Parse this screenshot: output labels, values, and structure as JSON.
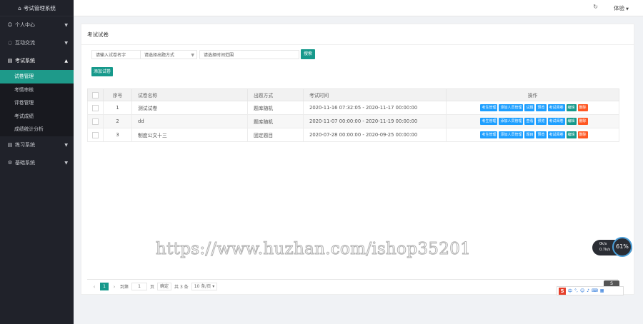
{
  "app_title": "考试管理系统",
  "sidebar": {
    "groups": [
      {
        "label": "个人中心"
      },
      {
        "label": "互动交流"
      },
      {
        "label": "考试系统"
      },
      {
        "label": "练习系统"
      },
      {
        "label": "基础系统"
      }
    ],
    "exam_subitems": [
      {
        "label": "试卷管理"
      },
      {
        "label": "考情审核"
      },
      {
        "label": "评卷管理"
      },
      {
        "label": "考试成绩"
      },
      {
        "label": "成绩统计分析"
      }
    ]
  },
  "header": {
    "user_name": "体验"
  },
  "page": {
    "title": "考试试卷",
    "filter": {
      "name_placeholder": "请输入试卷名字",
      "method_placeholder": "请选择出题方式",
      "time_placeholder": "请选择时间范围",
      "search_label": "搜索"
    },
    "new_button": "添加试卷"
  },
  "table": {
    "headers": [
      "序号",
      "试卷名称",
      "出题方式",
      "考试时间",
      "操作"
    ],
    "rows": [
      {
        "num": "1",
        "name": "测试试卷",
        "method": "题库随机",
        "time": "2020-11-16 07:32:05 - 2020-11-17 00:00:00",
        "ops": [
          "考生管理",
          "添加人员管理",
          "试题",
          "预览",
          "考试阅卷",
          "编辑",
          "删除"
        ]
      },
      {
        "num": "2",
        "name": "dd",
        "method": "题库随机",
        "time": "2020-11-07 00:00:00 - 2020-11-19 00:00:00",
        "ops": [
          "考生管理",
          "添加人员管理",
          "查看",
          "预览",
          "考试阅卷",
          "编辑",
          "删除"
        ]
      },
      {
        "num": "3",
        "name": "制度公文十三",
        "method": "固定题目",
        "time": "2020-07-28 00:00:00 - 2020-09-25 00:00:00",
        "ops": [
          "考生管理",
          "添加人员管理",
          "题目",
          "预览",
          "考试阅卷",
          "编辑",
          "删除"
        ]
      }
    ]
  },
  "pagination": {
    "current": "1",
    "goto_prefix": "到第",
    "goto_value": "1",
    "goto_suffix": "页",
    "confirm": "确定",
    "total": "共 3 条",
    "page_size": "10 条/页"
  },
  "watermark": "https://www.huzhan.com/ishop35201",
  "widgets": {
    "speed_up": "0k/s",
    "speed_down": "0.7k/s",
    "speed_percent": "61%",
    "ime_label": "中"
  },
  "colors": {
    "sidebar_bg": "#20222a",
    "accent": "#16998b",
    "op_blue": "#1e9fff",
    "op_red": "#ff5722"
  }
}
